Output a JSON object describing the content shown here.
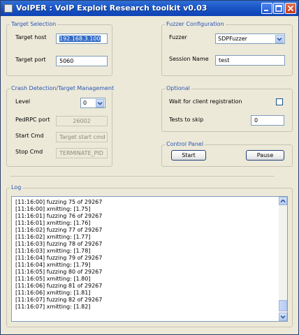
{
  "window": {
    "title": "VoIPER : VoIP Exploit Research toolkit v0.03",
    "controls": {
      "minimize": "minimize-icon",
      "maximize": "maximize-icon",
      "close": "close-icon"
    }
  },
  "target_selection": {
    "legend": "Target Selection",
    "host_label": "Target host",
    "host_value": "192.168.3.100",
    "port_label": "Target port",
    "port_value": "5060"
  },
  "fuzzer_config": {
    "legend": "Fuzzer Configuration",
    "fuzzer_label": "Fuzzer",
    "fuzzer_value": "SDPFuzzer",
    "session_label": "Session Name",
    "session_value": "test"
  },
  "crash_detection": {
    "legend": "Crash Detection/Target Management",
    "level_label": "Level",
    "level_value": "0",
    "pedrpc_label": "PedRPC port",
    "pedrpc_value": "26002",
    "start_label": "Start Cmd",
    "start_placeholder": "Target start cmd",
    "stop_label": "Stop Cmd",
    "stop_value": "TERMINATE_PID"
  },
  "optional": {
    "legend": "Optional",
    "wait_label": "Wait for client registration",
    "wait_checked": false,
    "skip_label": "Tests to skip",
    "skip_value": "0"
  },
  "control_panel": {
    "legend": "Control Panel",
    "start_label": "Start",
    "pause_label": "Pause"
  },
  "log": {
    "legend": "Log",
    "lines": [
      "[11:16:00] fuzzing 75 of 29267",
      "[11:16:00] xmitting: [1.75]",
      "[11:16:01] fuzzing 76 of 29267",
      "[11:16:01] xmitting: [1.76]",
      "[11:16:02] fuzzing 77 of 29267",
      "[11:16:02] xmitting: [1.77]",
      "[11:16:03] fuzzing 78 of 29267",
      "[11:16:03] xmitting: [1.78]",
      "[11:16:04] fuzzing 79 of 29267",
      "[11:16:04] xmitting: [1.79]",
      "[11:16:05] fuzzing 80 of 29267",
      "[11:16:05] xmitting: [1.80]",
      "[11:16:06] fuzzing 81 of 29267",
      "[11:16:06] xmitting: [1.81]",
      "[11:16:07] fuzzing 82 of 29267",
      "[11:16:07] xmitting: [1.82]"
    ]
  },
  "colors": {
    "titlebar": "#1b56c7",
    "legend_text": "#2a55b4",
    "window_bg": "#ece9d8",
    "selection": "#316ac5"
  }
}
